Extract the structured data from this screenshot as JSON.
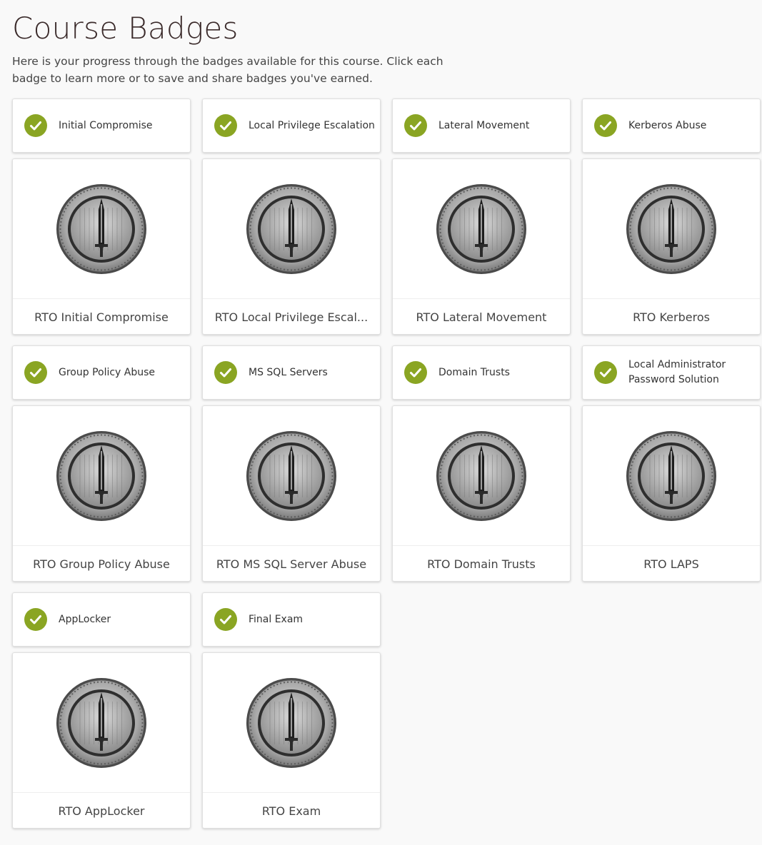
{
  "page": {
    "title": "Course Badges",
    "intro": "Here is your progress through the badges available for this course. Click each badge to learn more or to save and share badges you've earned."
  },
  "colors": {
    "check_green": "#8aa523",
    "title_color": "#3a2a2a"
  },
  "badges": [
    {
      "header": "Initial Compromise",
      "title": "RTO Initial Compromise",
      "status_icon": "checkmark-icon",
      "image_icon": "coin-dagger-badge-icon"
    },
    {
      "header": "Local Privilege Escalation",
      "title": "RTO Local Privilege Escal...",
      "status_icon": "checkmark-icon",
      "image_icon": "coin-dagger-badge-icon"
    },
    {
      "header": "Lateral Movement",
      "title": "RTO Lateral Movement",
      "status_icon": "checkmark-icon",
      "image_icon": "coin-dagger-badge-icon"
    },
    {
      "header": "Kerberos Abuse",
      "title": "RTO Kerberos",
      "status_icon": "checkmark-icon",
      "image_icon": "coin-dagger-badge-icon"
    },
    {
      "header": "Group Policy Abuse",
      "title": "RTO Group Policy Abuse",
      "status_icon": "checkmark-icon",
      "image_icon": "coin-dagger-badge-icon"
    },
    {
      "header": "MS SQL Servers",
      "title": "RTO MS SQL Server Abuse",
      "status_icon": "checkmark-icon",
      "image_icon": "coin-dagger-badge-icon"
    },
    {
      "header": "Domain Trusts",
      "title": "RTO Domain Trusts",
      "status_icon": "checkmark-icon",
      "image_icon": "coin-dagger-badge-icon"
    },
    {
      "header": "Local Administrator Password Solution",
      "title": "RTO LAPS",
      "status_icon": "checkmark-icon",
      "image_icon": "coin-dagger-badge-icon"
    },
    {
      "header": "AppLocker",
      "title": "RTO AppLocker",
      "status_icon": "checkmark-icon",
      "image_icon": "coin-dagger-badge-icon"
    },
    {
      "header": "Final Exam",
      "title": "RTO Exam",
      "status_icon": "checkmark-icon",
      "image_icon": "coin-dagger-badge-icon"
    }
  ]
}
